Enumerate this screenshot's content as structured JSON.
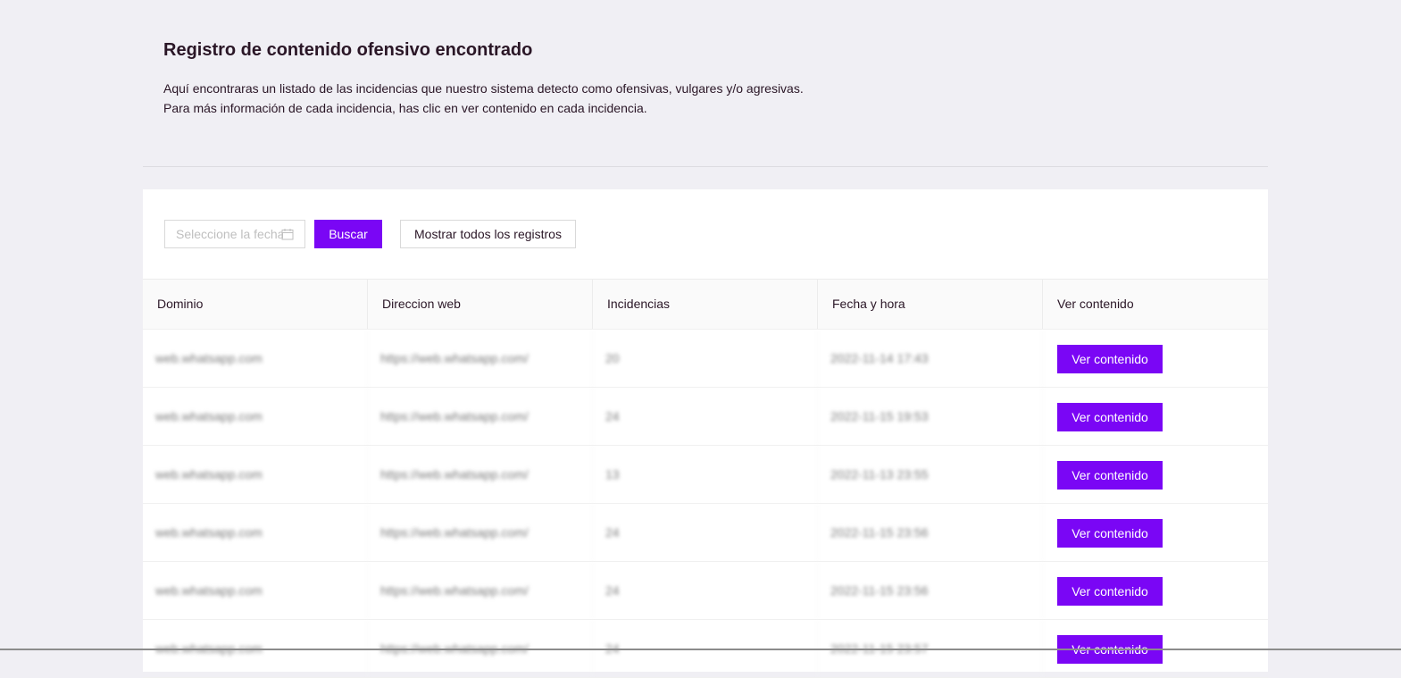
{
  "header": {
    "title": "Registro de contenido ofensivo encontrado",
    "description_line1": "Aquí encontraras un listado de las incidencias que nuestro sistema detecto como ofensivas, vulgares y/o agresivas.",
    "description_line2": "Para más información de cada incidencia, has clic en ver contenido en cada incidencia."
  },
  "toolbar": {
    "date_placeholder": "Seleccione la fecha",
    "search_label": "Buscar",
    "show_all_label": "Mostrar todos los registros"
  },
  "table": {
    "columns": [
      "Dominio",
      "Direccion web",
      "Incidencias",
      "Fecha y hora",
      "Ver contenido"
    ],
    "rows": [
      {
        "domain": "web.whatsapp.com",
        "url": "https://web.whatsapp.com/",
        "incidents": "20",
        "datetime": "2022-11-14 17:43",
        "action": "Ver contenido"
      },
      {
        "domain": "web.whatsapp.com",
        "url": "https://web.whatsapp.com/",
        "incidents": "24",
        "datetime": "2022-11-15 19:53",
        "action": "Ver contenido"
      },
      {
        "domain": "web.whatsapp.com",
        "url": "https://web.whatsapp.com/",
        "incidents": "13",
        "datetime": "2022-11-13 23:55",
        "action": "Ver contenido"
      },
      {
        "domain": "web.whatsapp.com",
        "url": "https://web.whatsapp.com/",
        "incidents": "24",
        "datetime": "2022-11-15 23:56",
        "action": "Ver contenido"
      },
      {
        "domain": "web.whatsapp.com",
        "url": "https://web.whatsapp.com/",
        "incidents": "24",
        "datetime": "2022-11-15 23:56",
        "action": "Ver contenido"
      },
      {
        "domain": "web.whatsapp.com",
        "url": "https://web.whatsapp.com/",
        "incidents": "24",
        "datetime": "2022-11-15 23:57",
        "action": "Ver contenido"
      }
    ]
  },
  "colors": {
    "accent": "#7a06f5",
    "page_background": "#f0eff4"
  },
  "icons": {
    "date_picker": "calendar-icon"
  }
}
